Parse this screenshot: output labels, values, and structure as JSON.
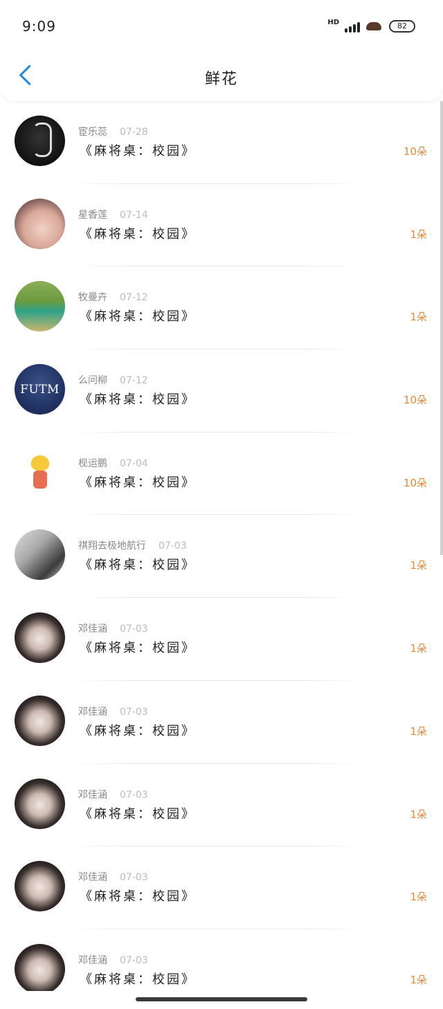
{
  "status_bar": {
    "time": "9:09",
    "hd_label": "HD",
    "battery": "82"
  },
  "nav": {
    "title": "鲜花"
  },
  "items": [
    {
      "name": "宦乐蕊",
      "date": "07-28",
      "title": "《麻将桌：校园》",
      "amount": "10朵",
      "avatar": "dragon-avatar"
    },
    {
      "name": "星香莲",
      "date": "07-14",
      "title": "《麻将桌：校园》",
      "amount": "1朵",
      "avatar": "girl-avatar"
    },
    {
      "name": "牧曼卉",
      "date": "07-12",
      "title": "《麻将桌：校园》",
      "amount": "1朵",
      "avatar": "boy-avatar"
    },
    {
      "name": "么问柳",
      "date": "07-12",
      "title": "《麻将桌：校园》",
      "amount": "10朵",
      "avatar": "futm-avatar",
      "avatar_text": "FUTM"
    },
    {
      "name": "枧运鹏",
      "date": "07-04",
      "title": "《麻将桌：校园》",
      "amount": "10朵",
      "avatar": "cartoon-avatar"
    },
    {
      "name": "祺翔去极地航行",
      "date": "07-03",
      "title": "《麻将桌：校园》",
      "amount": "1朵",
      "avatar": "couple-avatar"
    },
    {
      "name": "邓佳涵",
      "date": "07-03",
      "title": "《麻将桌：校园》",
      "amount": "1朵",
      "avatar": "dark-hair-girl-avatar"
    },
    {
      "name": "邓佳涵",
      "date": "07-03",
      "title": "《麻将桌：校园》",
      "amount": "1朵",
      "avatar": "dark-hair-girl-avatar"
    },
    {
      "name": "邓佳涵",
      "date": "07-03",
      "title": "《麻将桌：校园》",
      "amount": "1朵",
      "avatar": "dark-hair-girl-avatar"
    },
    {
      "name": "邓佳涵",
      "date": "07-03",
      "title": "《麻将桌：校园》",
      "amount": "1朵",
      "avatar": "dark-hair-girl-avatar"
    },
    {
      "name": "邓佳涵",
      "date": "07-03",
      "title": "《麻将桌：校园》",
      "amount": "1朵",
      "avatar": "dark-hair-girl-avatar"
    }
  ],
  "colors": {
    "accent_blue": "#1e88e5",
    "amount_orange": "#e58a3a"
  }
}
